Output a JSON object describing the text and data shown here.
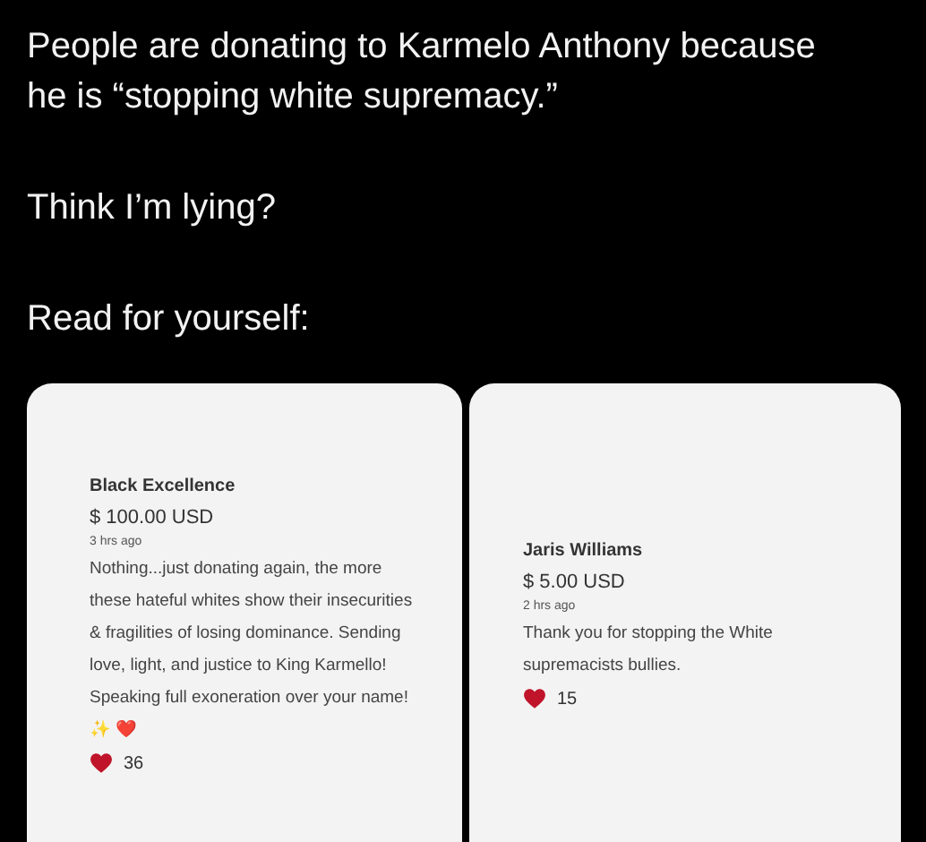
{
  "post": {
    "paragraphs": [
      "People are donating to Karmelo Anthony because he is “stopping white supremacy.”",
      "Think I’m lying?",
      "Read for yourself:"
    ]
  },
  "donations": [
    {
      "name": "Black Excellence",
      "amount": "$ 100.00 USD",
      "time": "3 hrs ago",
      "message": "Nothing...just donating again, the more these hateful whites show their insecurities & fragilities of losing dominance. Sending love, light, and justice to King Karmello! Speaking full exoneration over your name! ✨ ❤️",
      "likes": "36"
    },
    {
      "name": "Jaris Williams",
      "amount": "$ 5.00 USD",
      "time": "2 hrs ago",
      "message": "Thank you for stopping the White supremacists bullies.",
      "likes": "15"
    }
  ]
}
